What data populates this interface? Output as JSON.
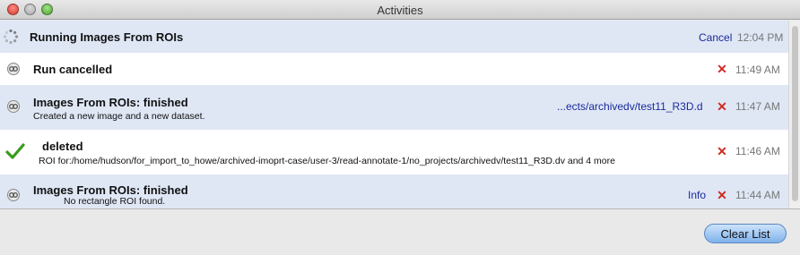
{
  "window": {
    "title": "Activities"
  },
  "activities": [
    {
      "title": "Running Images From ROIs",
      "subtitle": "",
      "link": "Cancel",
      "time": "12:04 PM",
      "status": "running"
    },
    {
      "title": "Run cancelled",
      "subtitle": "",
      "link": "",
      "time": "11:49 AM",
      "status": "done"
    },
    {
      "title": "Images From ROIs: finished",
      "subtitle": "Created a new image and a new dataset.",
      "link": "...ects/archivedv/test11_R3D.d",
      "time": "11:47 AM",
      "status": "done"
    },
    {
      "title": "deleted",
      "subtitle": "ROI for:/home/hudson/for_import_to_howe/archived-imoprt-case/user-3/read-annotate-1/no_projects/archivedv/test11_R3D.dv and 4 more",
      "link": "",
      "time": "11:46 AM",
      "status": "success"
    },
    {
      "title": "Images From ROIs: finished",
      "subtitle": "No rectangle ROI found.",
      "link": "Info",
      "time": "11:44 AM",
      "status": "done"
    }
  ],
  "footer": {
    "clear_label": "Clear List"
  },
  "colors": {
    "accent": "#1a2a9c",
    "remove": "#d02a22",
    "row_alt": "#dfe7f5",
    "success": "#3a9a1c"
  }
}
